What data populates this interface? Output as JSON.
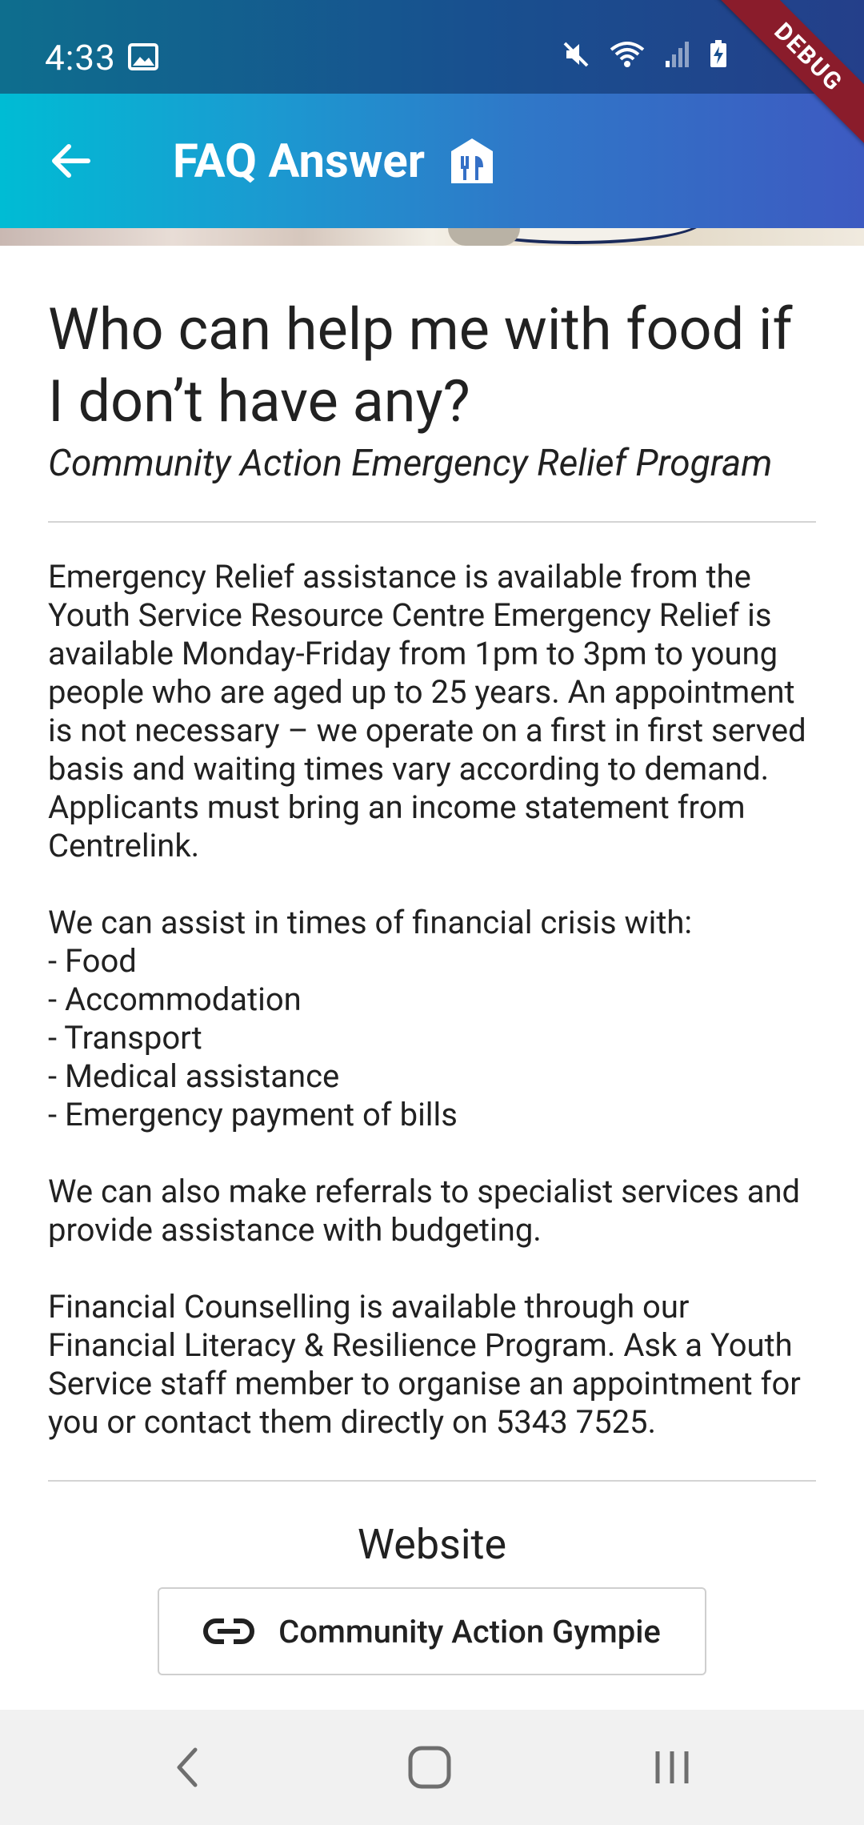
{
  "status_bar": {
    "time": "4:33",
    "icons": [
      "image-icon",
      "mute-icon",
      "wifi-icon",
      "signal-icon",
      "battery-charging-icon"
    ]
  },
  "debug_banner": "DEBUG",
  "app_bar": {
    "title": "FAQ Answer",
    "back_icon": "arrow-left-icon",
    "title_icon": "store-icon"
  },
  "faq": {
    "question": "Who can help me with food if I don’t have any?",
    "organization": "Community Action Emergency Relief Program",
    "answer": {
      "paragraph1": "Emergency Relief assistance is available from the Youth Service Resource Centre Emergency Relief is available Monday-Friday from 1pm to 3pm to young people who are aged up to 25 years. An appointment is not necessary – we operate on a first in first served basis and waiting times vary according to demand. Applicants must bring an income statement from Centrelink.",
      "list_intro": "We can assist in times of financial crisis with:",
      "list": [
        "- Food",
        "- Accommodation",
        "- Transport",
        "- Medical assistance",
        "- Emergency payment of bills"
      ],
      "paragraph2": "We can also make referrals to specialist services and provide assistance with budgeting.",
      "paragraph3": "Financial Counselling is available through our Financial Literacy & Resilience Program. Ask a Youth Service staff member to organise an appointment for you or contact them directly on 5343 7525."
    }
  },
  "website": {
    "label": "Website",
    "link_text": "Community Action Gympie",
    "link_icon": "link-icon"
  },
  "nav_bar": {
    "buttons": [
      "back-nav-icon",
      "home-nav-icon",
      "recents-nav-icon"
    ]
  },
  "colors": {
    "app_bar_start": "#00bcd4",
    "app_bar_end": "#3d5ac1",
    "debug_ribbon": "#8a1c2b",
    "text": "#212121",
    "divider": "#d4d4d4"
  }
}
